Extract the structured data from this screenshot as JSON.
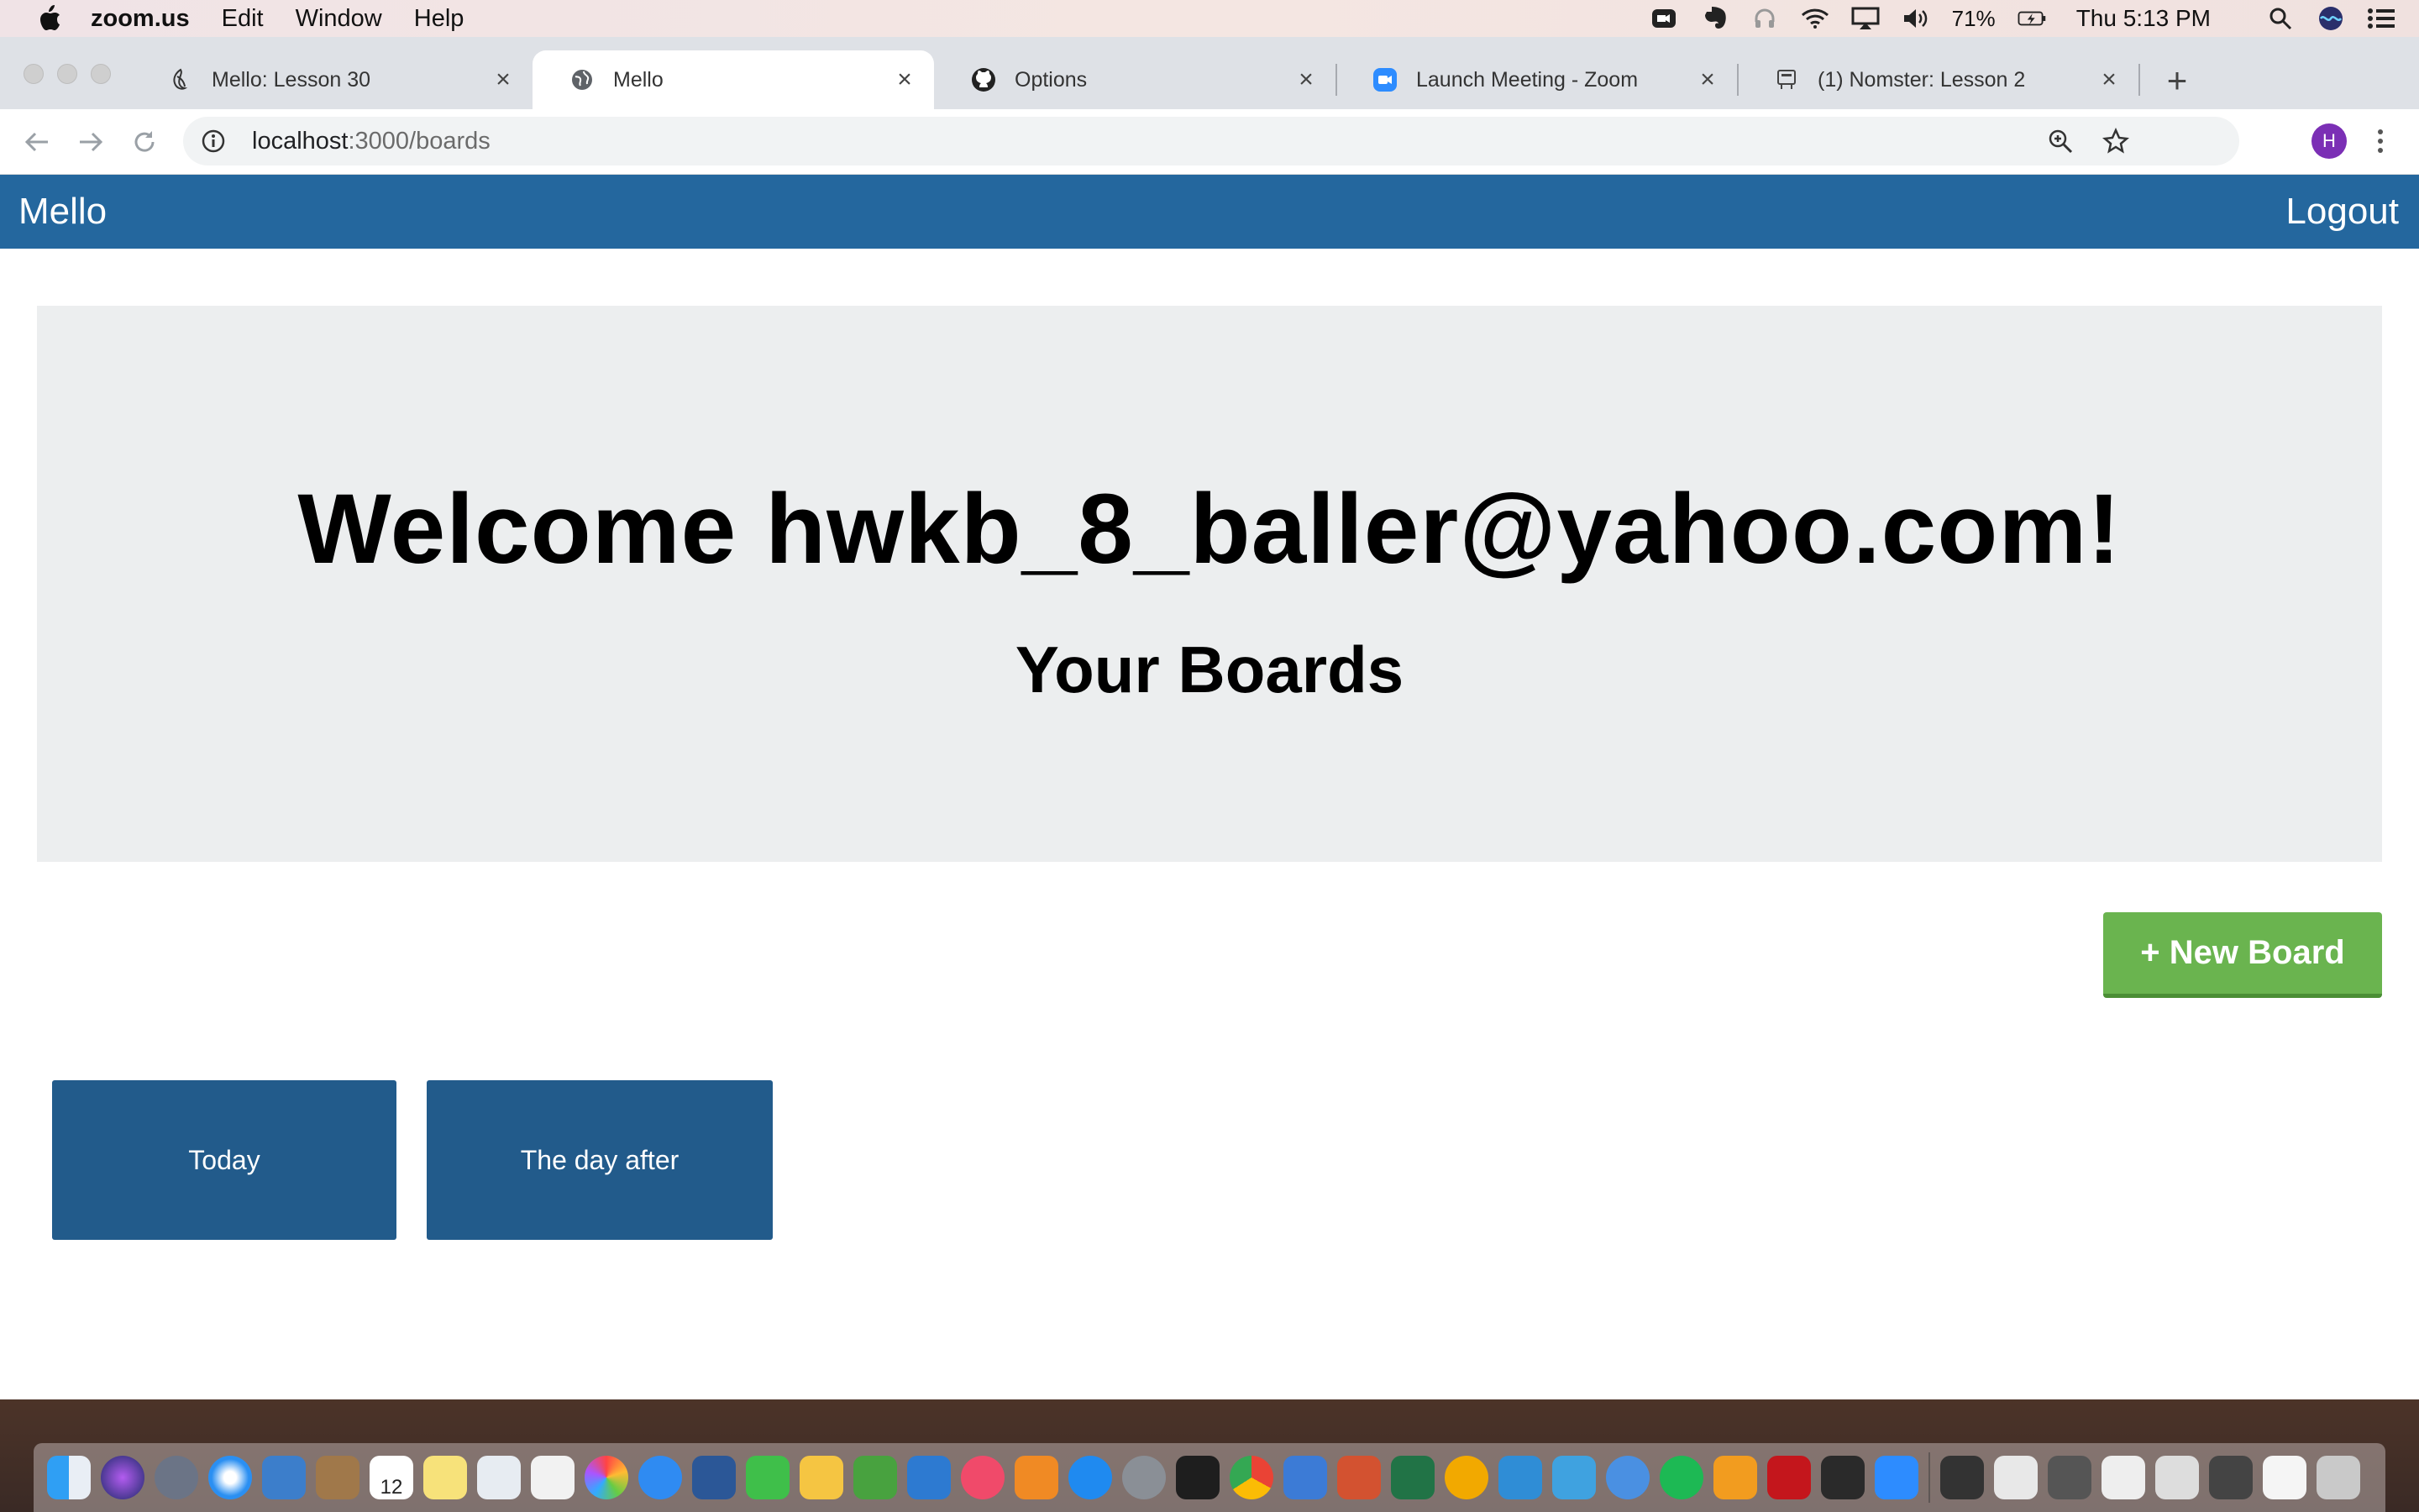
{
  "menubar": {
    "app_name": "zoom.us",
    "menus": [
      "Edit",
      "Window",
      "Help"
    ],
    "battery_percent": "71%",
    "clock": "Thu 5:13 PM"
  },
  "browser": {
    "tabs": [
      {
        "title": "Mello: Lesson 30",
        "icon": "lesson-icon"
      },
      {
        "title": "Mello",
        "icon": "globe-icon"
      },
      {
        "title": "Options",
        "icon": "github-icon"
      },
      {
        "title": "Launch Meeting - Zoom",
        "icon": "zoom-icon"
      },
      {
        "title": "(1) Nomster: Lesson 2",
        "icon": "lesson-icon"
      }
    ],
    "url_host": "localhost",
    "url_path": ":3000/boards",
    "profile_initial": "H"
  },
  "app": {
    "brand": "Mello",
    "logout": "Logout",
    "welcome": "Welcome hwkb_8_baller@yahoo.com!",
    "subtitle": "Your Boards",
    "new_board": "+ New Board",
    "boards": [
      "Today",
      "The day after"
    ]
  },
  "colors": {
    "navbar": "#24679e",
    "board_tile": "#225b8b",
    "new_board_button": "#6ab44f",
    "jumbotron": "#eceeef"
  },
  "dock": {
    "calendar_day": "12"
  }
}
